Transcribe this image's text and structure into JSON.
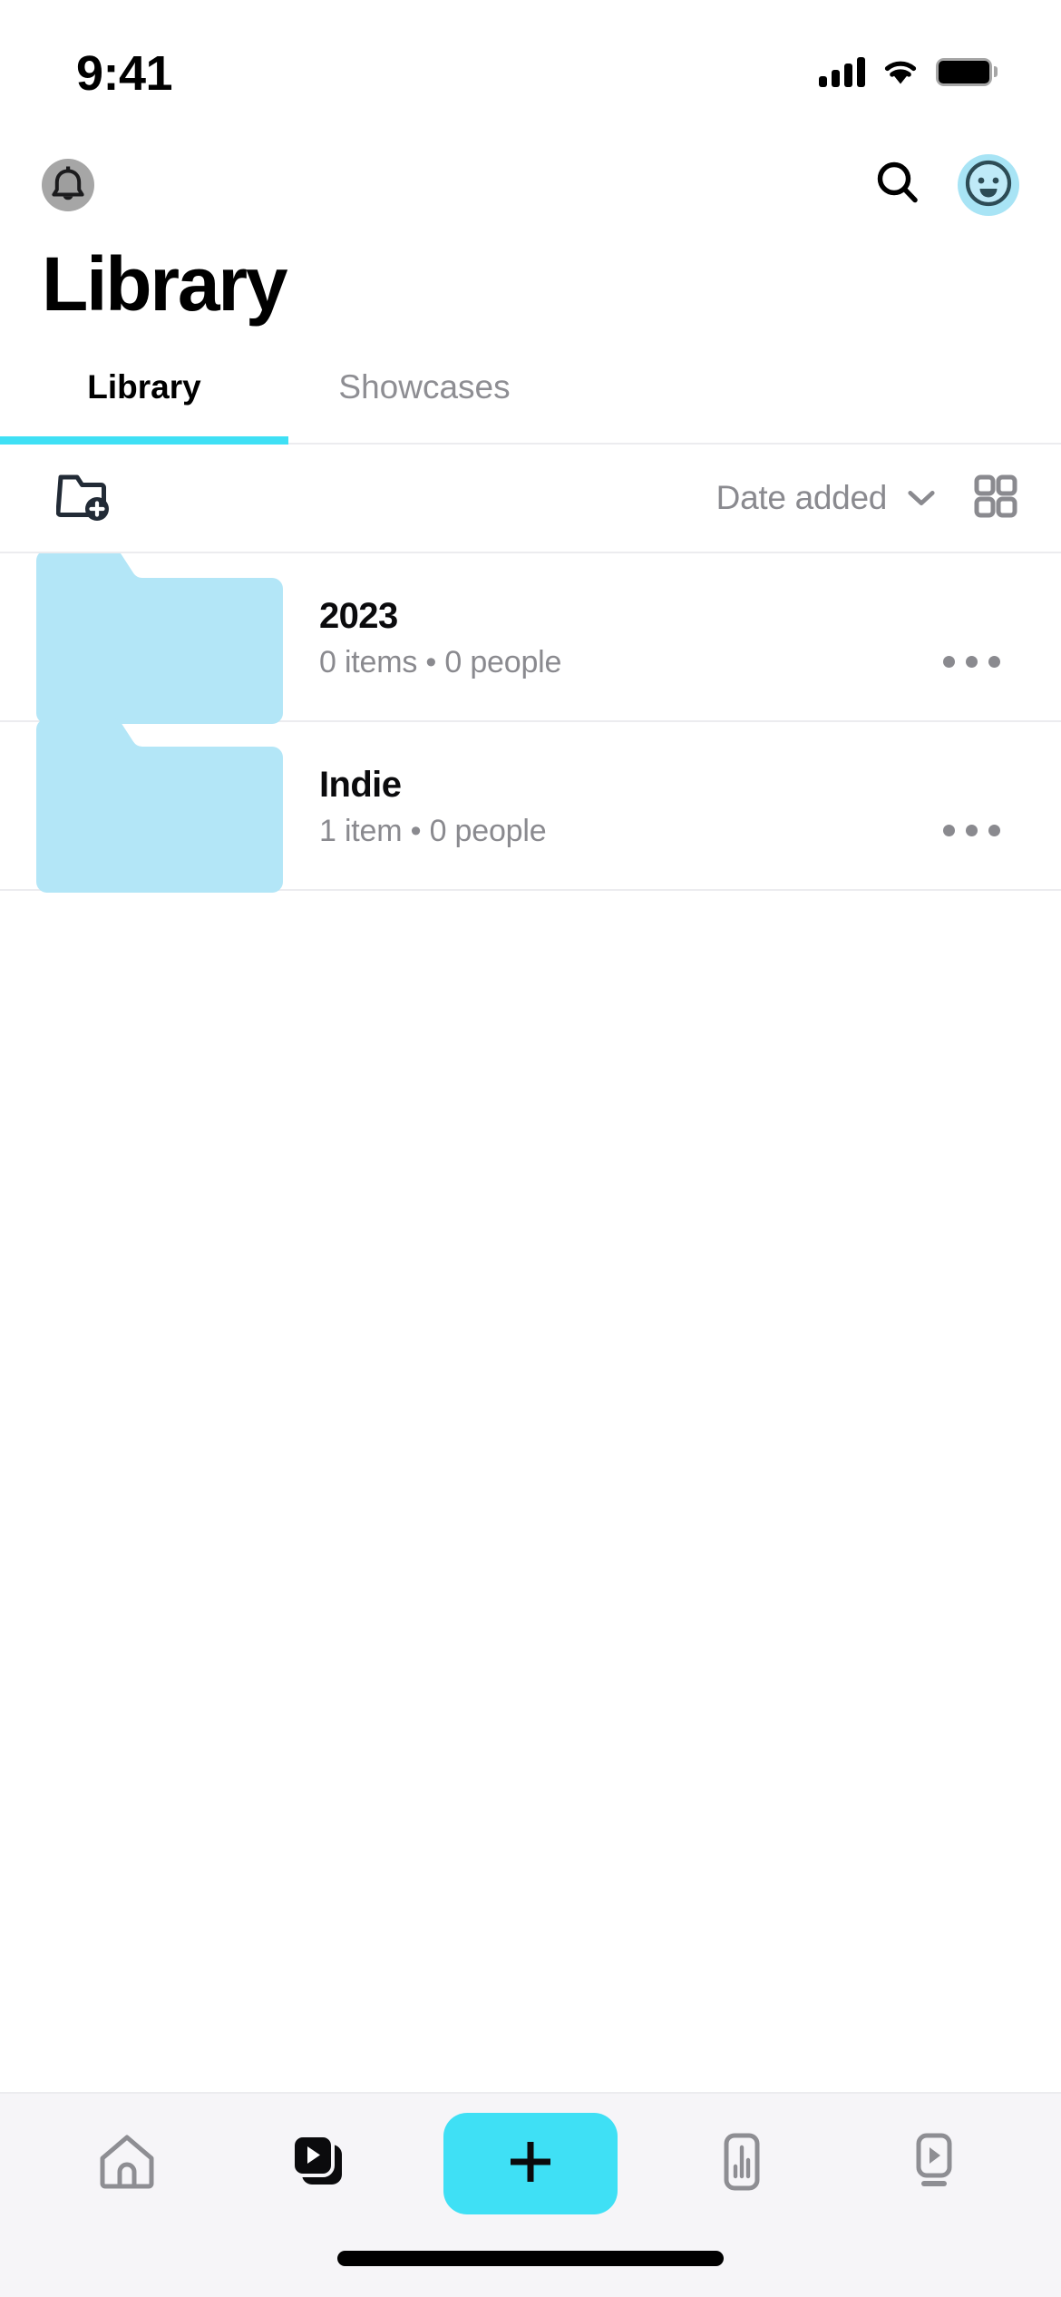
{
  "status_bar": {
    "time": "9:41",
    "signal_icon": "cellular-signal-icon",
    "wifi_icon": "wifi-icon",
    "battery_icon": "battery-icon"
  },
  "app_bar": {
    "notifications_icon": "bell-icon",
    "search_icon": "search-icon",
    "avatar_icon": "avatar-smiley-icon",
    "avatar_bg_color": "#a8e4f5"
  },
  "header": {
    "title": "Library"
  },
  "tabs": {
    "items": [
      {
        "label": "Library",
        "active": true
      },
      {
        "label": "Showcases",
        "active": false
      }
    ],
    "active_underline_color": "#3fe0f5"
  },
  "toolbar": {
    "new_folder_icon": "folder-plus-icon",
    "sort_label": "Date added",
    "sort_chevron_icon": "chevron-down-icon",
    "grid_view_icon": "grid-view-icon"
  },
  "folders": [
    {
      "name": "2023",
      "subtitle": "0 items • 0 people",
      "thumb_color": "#b3e6f7",
      "more_icon": "more-horizontal-icon"
    },
    {
      "name": "Indie",
      "subtitle": "1 item • 0 people",
      "thumb_color": "#b3e6f7",
      "more_icon": "more-horizontal-icon"
    }
  ],
  "bottom_nav": {
    "items": [
      {
        "name": "home",
        "icon": "home-icon",
        "active": false
      },
      {
        "name": "library",
        "icon": "video-stack-icon",
        "active": true
      },
      {
        "name": "create",
        "icon": "plus-icon",
        "active": false,
        "accent": "#3fe0f5"
      },
      {
        "name": "insights",
        "icon": "bar-chart-icon",
        "active": false
      },
      {
        "name": "showcase",
        "icon": "tv-play-icon",
        "active": false
      }
    ]
  },
  "home_indicator": {
    "icon": "home-indicator-bar"
  }
}
